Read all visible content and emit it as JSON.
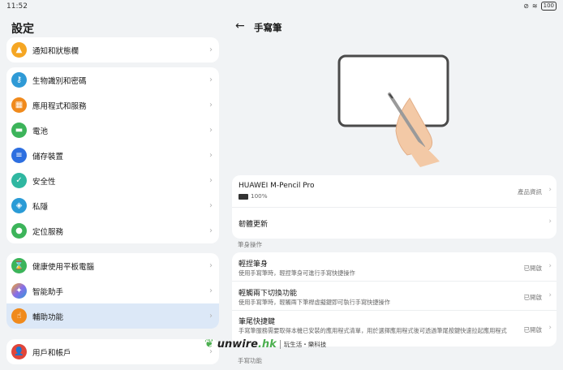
{
  "status": {
    "time": "11:52",
    "battery": "100"
  },
  "left": {
    "title": "設定",
    "groups": [
      [
        {
          "label": "通知和狀態欄",
          "icon": "bell-icon",
          "color": "#f5a623"
        }
      ],
      [
        {
          "label": "生物識別和密碼",
          "icon": "key-icon",
          "color": "#2f9ad6"
        },
        {
          "label": "應用程式和服務",
          "icon": "apps-icon",
          "color": "#f08a1c"
        },
        {
          "label": "電池",
          "icon": "battery-icon",
          "color": "#3cb45a"
        },
        {
          "label": "儲存裝置",
          "icon": "storage-icon",
          "color": "#2d6fe0"
        },
        {
          "label": "安全性",
          "icon": "shield-icon",
          "color": "#2fb7a1"
        },
        {
          "label": "私隱",
          "icon": "privacy-icon",
          "color": "#2a9bd6"
        },
        {
          "label": "定位服務",
          "icon": "location-icon",
          "color": "#3cb45a"
        }
      ],
      [
        {
          "label": "健康使用平板電腦",
          "icon": "hourglass-icon",
          "color": "#3cb45a"
        },
        {
          "label": "智能助手",
          "icon": "assistant-icon",
          "color": "#8a6de9"
        },
        {
          "label": "輔助功能",
          "icon": "hand-icon",
          "color": "#f08a1c"
        }
      ],
      [
        {
          "label": "用戶和帳戶",
          "icon": "user-icon",
          "color": "#e0453a"
        }
      ]
    ]
  },
  "right": {
    "title": "手寫筆",
    "device": {
      "name": "HUAWEI M-Pencil Pro",
      "battery": "100%",
      "info_label": "產品資訊"
    },
    "firmware_label": "韌體更新",
    "section1": "筆身操作",
    "ops": [
      {
        "title": "輕捏筆身",
        "desc": "使用手寫筆時，輕捏筆身可進行手寫快捷操作",
        "value": "已開啟"
      },
      {
        "title": "輕觸兩下切換功能",
        "desc": "使用手寫筆時，輕觸兩下筆桿虛擬鍵即可執行手寫快捷操作",
        "value": "已開啟"
      },
      {
        "title": "筆尾快捷鍵",
        "desc": "手寫筆服務需要取得本機已安裝的應用程式清單，用於選擇應用程式後可透過筆尾按鍵快速拉起應用程式",
        "value": "已開啟"
      }
    ],
    "section2": "手寫功能"
  },
  "watermark": {
    "brand": "unwire",
    "domain": ".hk",
    "tagline": "玩生活・樂科技"
  }
}
